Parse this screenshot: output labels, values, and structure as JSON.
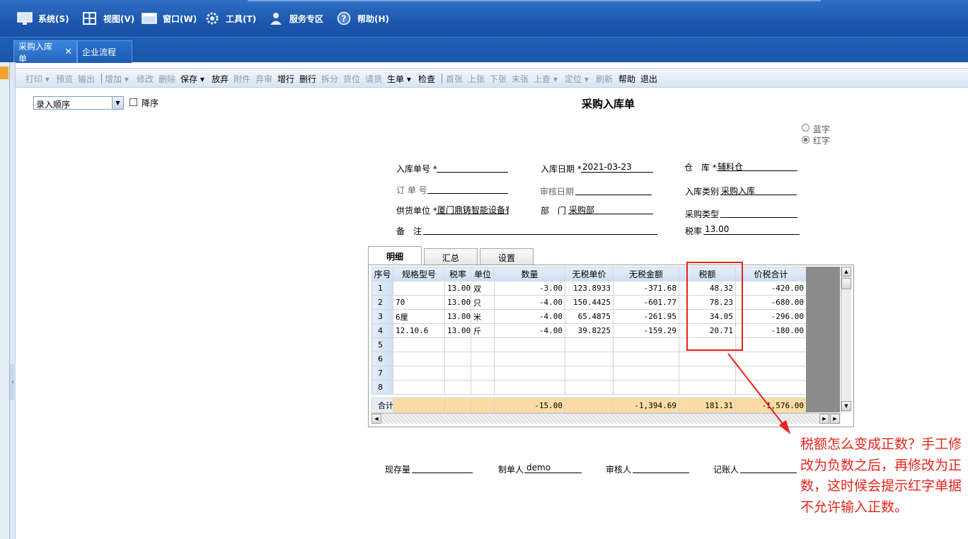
{
  "menu": [
    {
      "label": "系统(S)",
      "icon": "monitor-icon"
    },
    {
      "label": "视图(V)",
      "icon": "grid-view-icon"
    },
    {
      "label": "窗口(W)",
      "icon": "window-icon"
    },
    {
      "label": "工具(T)",
      "icon": "gear-icon"
    },
    {
      "label": "服务专区",
      "icon": "user-icon"
    },
    {
      "label": "帮助(H)",
      "icon": "help-icon"
    }
  ],
  "tabs": [
    {
      "label": "采购入库单",
      "active": true
    },
    {
      "label": "企业流程",
      "active": false
    }
  ],
  "toolbar": [
    {
      "label": "打印 ▾",
      "enabled": false
    },
    {
      "label": "预览",
      "enabled": false
    },
    {
      "label": "输出",
      "enabled": false
    },
    {
      "label": "增加 ▾",
      "enabled": false
    },
    {
      "label": "修改",
      "enabled": false
    },
    {
      "label": "删除",
      "enabled": false
    },
    {
      "label": "保存 ▾",
      "enabled": true
    },
    {
      "label": "放弃",
      "enabled": true
    },
    {
      "label": "附件",
      "enabled": false
    },
    {
      "label": "弃审",
      "enabled": false
    },
    {
      "label": "增行",
      "enabled": true
    },
    {
      "label": "删行",
      "enabled": true
    },
    {
      "label": "拆分",
      "enabled": false
    },
    {
      "label": "货位",
      "enabled": false
    },
    {
      "label": "请货",
      "enabled": false
    },
    {
      "label": "生单 ▾",
      "enabled": true
    },
    {
      "label": "检查",
      "enabled": true
    },
    {
      "label": "首张",
      "enabled": false
    },
    {
      "label": "上张",
      "enabled": false
    },
    {
      "label": "下张",
      "enabled": false
    },
    {
      "label": "末张",
      "enabled": false
    },
    {
      "label": "上查 ▾",
      "enabled": false
    },
    {
      "label": "定位 ▾",
      "enabled": false
    },
    {
      "label": "刷新",
      "enabled": false
    },
    {
      "label": "帮助",
      "enabled": true
    },
    {
      "label": "退出",
      "enabled": true
    }
  ],
  "sort": {
    "value": "录入顺序",
    "descending_label": "降序",
    "descending": false
  },
  "form": {
    "title": "采购入库单",
    "color_mode": {
      "blue_label": "蓝字",
      "red_label": "红字",
      "selected": "red"
    },
    "fields": {
      "receipt_no": {
        "label": "入库单号 *",
        "value": ""
      },
      "receipt_date": {
        "label": "入库日期 *",
        "value": "2021-03-23"
      },
      "warehouse": {
        "label": "仓　库 *",
        "value": "辅料仓"
      },
      "order_no": {
        "label": "订 单 号",
        "value": ""
      },
      "audit_date": {
        "label": "审核日期",
        "value": ""
      },
      "receipt_type": {
        "label": "入库类别",
        "value": "采购入库"
      },
      "supplier": {
        "label": "供货单位 *",
        "value": "厦门鼎铸智能设备有"
      },
      "department": {
        "label": "部　门",
        "value": "采购部"
      },
      "purchase_type": {
        "label": "采购类型",
        "value": ""
      },
      "remark": {
        "label": "备　注",
        "value": ""
      },
      "tax_rate": {
        "label": "税率",
        "value": "13.00"
      }
    }
  },
  "grid_tabs": [
    "明细",
    "汇总",
    "设置"
  ],
  "grid": {
    "columns": [
      "序号",
      "规格型号",
      "税率",
      "单位",
      "数量",
      "无税单价",
      "无税金额",
      "税额",
      "价税合计"
    ],
    "rows": [
      [
        "1",
        "",
        "13.00",
        "双",
        "-3.00",
        "123.8933",
        "-371.68",
        "48.32",
        "-420.00"
      ],
      [
        "2",
        "70",
        "13.00",
        "只",
        "-4.00",
        "150.4425",
        "-601.77",
        "78.23",
        "-680.00"
      ],
      [
        "3",
        "6厘",
        "13.00",
        "米",
        "-4.00",
        "65.4875",
        "-261.95",
        "34.05",
        "-296.00"
      ],
      [
        "4",
        "12.10.6",
        "13.00",
        "斤",
        "-4.00",
        "39.8225",
        "-159.29",
        "20.71",
        "-180.00"
      ],
      [
        "5",
        "",
        "",
        "",
        "",
        "",
        "",
        "",
        ""
      ],
      [
        "6",
        "",
        "",
        "",
        "",
        "",
        "",
        "",
        ""
      ],
      [
        "7",
        "",
        "",
        "",
        "",
        "",
        "",
        "",
        ""
      ],
      [
        "8",
        "",
        "",
        "",
        "",
        "",
        "",
        "",
        ""
      ]
    ],
    "total": [
      "合计",
      "",
      "",
      "",
      "-15.00",
      "",
      "-1,394.69",
      "181.31",
      "-1,576.00"
    ]
  },
  "footer": {
    "stock_label": "现存量",
    "stock_value": "",
    "maker_label": "制单人",
    "maker_value": "demo",
    "auditor_label": "审核人",
    "auditor_value": "",
    "bookkeeper_label": "记账人",
    "bookkeeper_value": ""
  },
  "annotation": {
    "text": "税额怎么变成正数？手工修改为负数之后，再修改为正数，这时候会提示红字单据不允许输入正数。",
    "color": "#e8231b"
  }
}
